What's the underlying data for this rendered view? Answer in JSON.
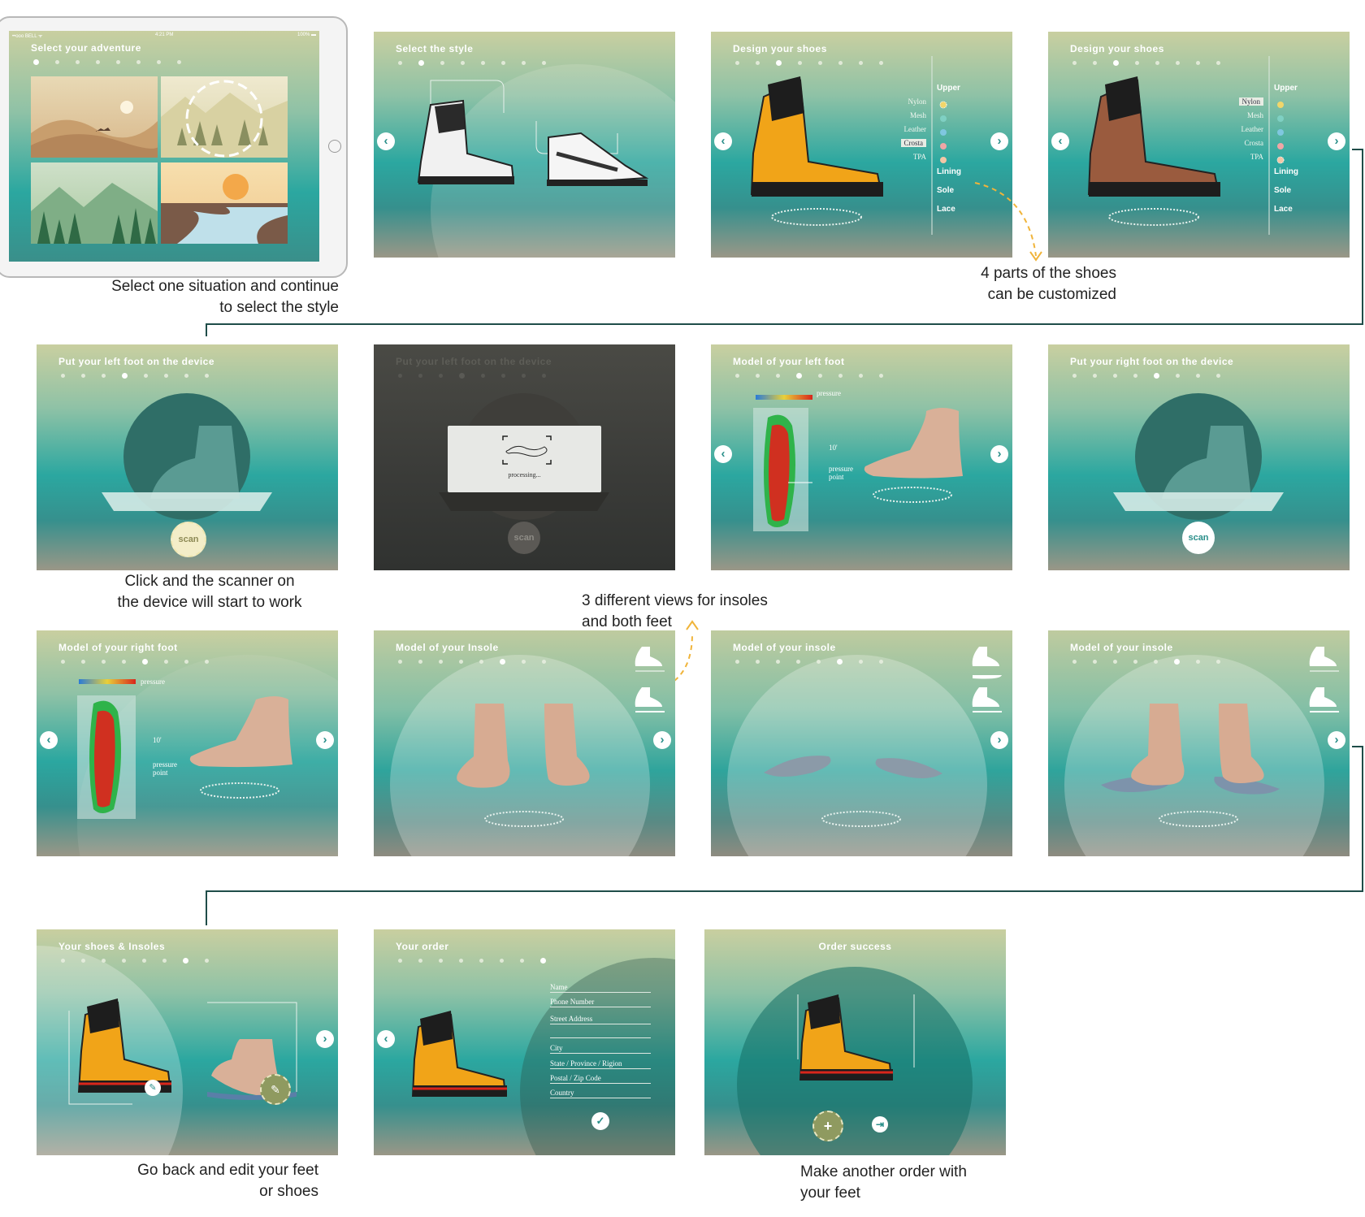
{
  "tablet": {
    "title": "Select your adventure",
    "status_left": "••ooo BELL ᯤ",
    "status_center": "4:21 PM",
    "status_right": "100% ▬"
  },
  "screens": {
    "s2": {
      "title": "Select the style"
    },
    "s3": {
      "title": "Design your shoes",
      "materials": [
        "Nylon",
        "Mesh",
        "Leather",
        "Crosta",
        "TPA"
      ],
      "selected": "Crosta",
      "parts": [
        "Upper",
        "Lining",
        "Sole",
        "Lace"
      ]
    },
    "s4": {
      "title": "Design your shoes",
      "materials": [
        "Nylon",
        "Mesh",
        "Leather",
        "Crosta",
        "TPA"
      ],
      "selected": "Nylon",
      "parts": [
        "Upper",
        "Lining",
        "Sole",
        "Lace"
      ]
    },
    "s5": {
      "title": "Put your left foot on the device",
      "button": "scan"
    },
    "s6": {
      "title": "Put your left foot on the device",
      "processing": "processing...",
      "button": "scan"
    },
    "s7": {
      "title": "Model of your left foot",
      "pressure": "pressure",
      "angle": "10'",
      "pressure_point": "pressure point"
    },
    "s8": {
      "title": "Put your right foot on the device",
      "button": "scan"
    },
    "s9": {
      "title": "Model of your right foot",
      "pressure": "pressure",
      "angle": "10'",
      "pressure_point": "pressure point"
    },
    "s10": {
      "title": "Model of your Insole"
    },
    "s11": {
      "title": "Model of your insole"
    },
    "s12": {
      "title": "Model of your insole"
    },
    "s13": {
      "title": "Your shoes & Insoles"
    },
    "s14": {
      "title": "Your order",
      "fields": [
        "Name",
        "Phone Number",
        "Street Address",
        "",
        "City",
        "State / Province / Rigion",
        "Postal / Zip Code",
        "Country"
      ]
    },
    "s15": {
      "title": "Order success"
    }
  },
  "captions": {
    "c1": "Select one situation and continue",
    "c1b": "to select the style",
    "c2": "4 parts of the shoes",
    "c2b": "can be customized",
    "c3": "Click and the scanner on",
    "c3b": "the device will start to work",
    "c4": "3 different views for insoles",
    "c4b": "and both feet",
    "c5": "Go back and edit your feet",
    "c5b": "or shoes",
    "c6": "Make another order with",
    "c6b": "your feet"
  },
  "colors": {
    "accent": "#2ba7a0",
    "arrow": "#f0b43a",
    "connector": "#1f4d49",
    "boot": "#f1a418"
  }
}
